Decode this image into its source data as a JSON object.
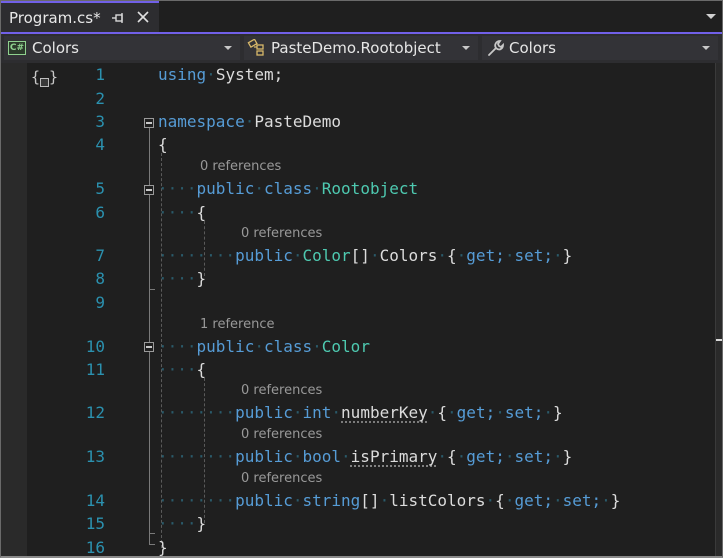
{
  "tab": {
    "title": "Program.cs*",
    "pin_icon": "pin-icon",
    "close_icon": "close-icon"
  },
  "navbar": {
    "project": {
      "label": "Colors",
      "icon": "csharp-project-icon"
    },
    "type": {
      "label": "PasteDemo.Rootobject",
      "icon": "class-icon"
    },
    "member": {
      "label": "Colors",
      "icon": "wrench-property-icon"
    }
  },
  "editor": {
    "accent_color": "#7160e8",
    "lines": [
      {
        "num": "1"
      },
      {
        "num": "2"
      },
      {
        "num": "3"
      },
      {
        "num": "4"
      },
      {
        "num": "5"
      },
      {
        "num": "6"
      },
      {
        "num": "7"
      },
      {
        "num": "8"
      },
      {
        "num": "9"
      },
      {
        "num": "10"
      },
      {
        "num": "11"
      },
      {
        "num": "12"
      },
      {
        "num": "13"
      },
      {
        "num": "14"
      },
      {
        "num": "15"
      },
      {
        "num": "16"
      }
    ],
    "codelens": {
      "rootobject": "0 references",
      "colors_prop": "0 references",
      "color_class": "1 reference",
      "numberkey": "0 references",
      "isprimary": "0 references",
      "listcolors": "0 references"
    },
    "tokens": {
      "using": "using",
      "system": "System;",
      "namespace": "namespace",
      "pastedemo": "PasteDemo",
      "open_brace": "{",
      "close_brace": "}",
      "public": "public",
      "class": "class",
      "rootobject": "Rootobject",
      "color_type": "Color",
      "brackets": "[]",
      "colors": "Colors",
      "get": "get;",
      "set": "set;",
      "int": "int",
      "numberkey": "numberKey",
      "bool": "bool",
      "isprimary": "isPrimary",
      "string": "string",
      "listcolors": "listColors"
    }
  }
}
